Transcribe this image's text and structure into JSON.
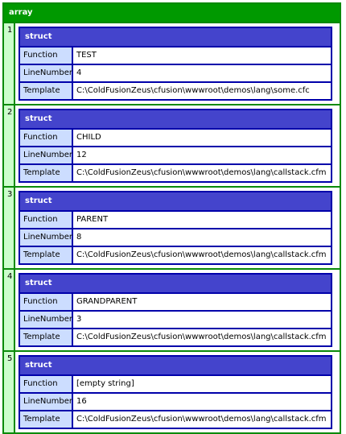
{
  "array_label": "array",
  "struct_label": "struct",
  "keys": [
    "Function",
    "LineNumber",
    "Template"
  ],
  "items": [
    {
      "index": "1",
      "Function": "TEST",
      "LineNumber": "4",
      "Template": "C:\\ColdFusionZeus\\cfusion\\wwwroot\\demos\\lang\\some.cfc"
    },
    {
      "index": "2",
      "Function": "CHILD",
      "LineNumber": "12",
      "Template": "C:\\ColdFusionZeus\\cfusion\\wwwroot\\demos\\lang\\callstack.cfm"
    },
    {
      "index": "3",
      "Function": "PARENT",
      "LineNumber": "8",
      "Template": "C:\\ColdFusionZeus\\cfusion\\wwwroot\\demos\\lang\\callstack.cfm"
    },
    {
      "index": "4",
      "Function": "GRANDPARENT",
      "LineNumber": "3",
      "Template": "C:\\ColdFusionZeus\\cfusion\\wwwroot\\demos\\lang\\callstack.cfm"
    },
    {
      "index": "5",
      "Function": "[empty string]",
      "LineNumber": "16",
      "Template": "C:\\ColdFusionZeus\\cfusion\\wwwroot\\demos\\lang\\callstack.cfm"
    }
  ],
  "colors": {
    "array_header": "#009900",
    "array_border": "#0a8a0a",
    "index_cell": "#ccffcc",
    "struct_header": "#4444cc",
    "struct_border": "#0000aa",
    "key_cell": "#ccddff"
  }
}
